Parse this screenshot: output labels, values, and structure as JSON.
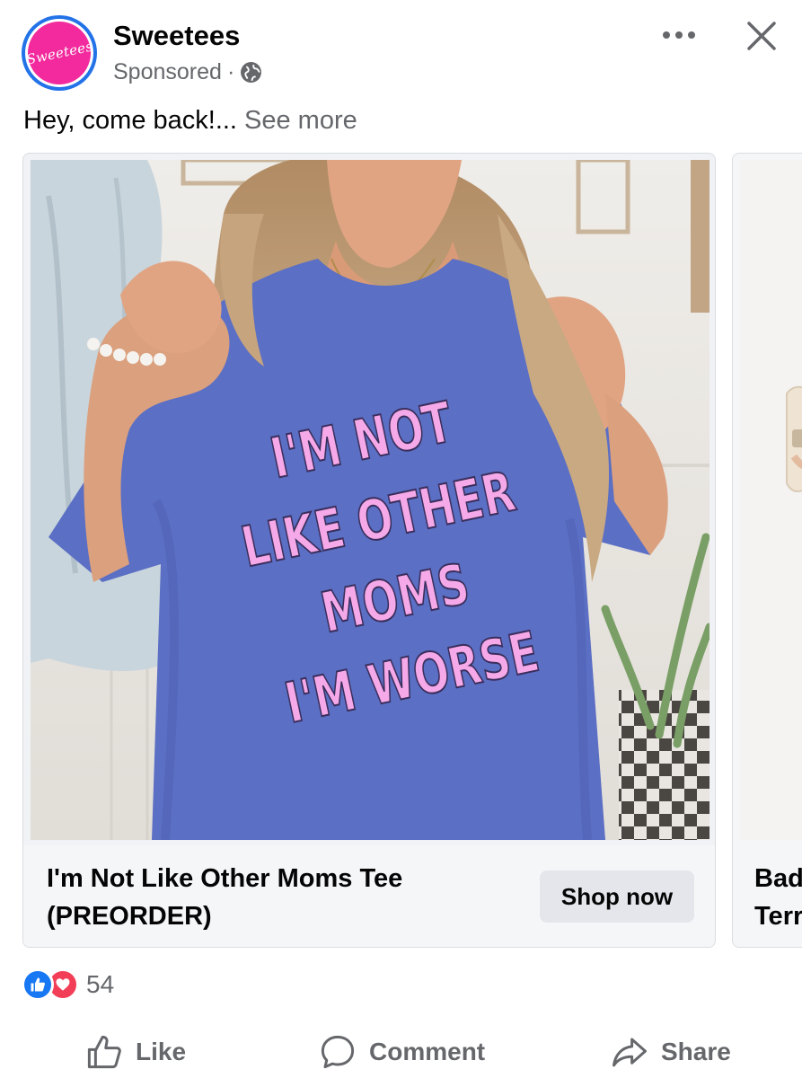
{
  "post": {
    "page_name": "Sweetees",
    "avatar_text": "Sweetees",
    "sponsored_label": "Sponsored",
    "separator": "·",
    "audience_icon": "globe-icon",
    "caption": "Hey, come back!...",
    "see_more": "See more"
  },
  "carousel": {
    "cards": [
      {
        "image_text_lines": [
          "I'M NOT",
          "LIKE OTHER",
          "MOMS",
          "I'M WORSE"
        ],
        "title": "I'm Not Like Other Moms Tee (PREORDER)",
        "cta": "Shop now"
      },
      {
        "title": "Bad\nTerr"
      }
    ]
  },
  "reactions": {
    "icons": [
      "like-reaction-icon",
      "love-reaction-icon"
    ],
    "count": "54"
  },
  "actions": {
    "like": "Like",
    "comment": "Comment",
    "share": "Share"
  },
  "colors": {
    "brand_pink": "#f22a9d",
    "avatar_ring": "#2372e8",
    "shirt_blue": "#5b6fc4",
    "print_pink": "#f6a9e8",
    "like_blue": "#1877f2",
    "love_red": "#f33e58",
    "secondary_text": "#65676b"
  }
}
